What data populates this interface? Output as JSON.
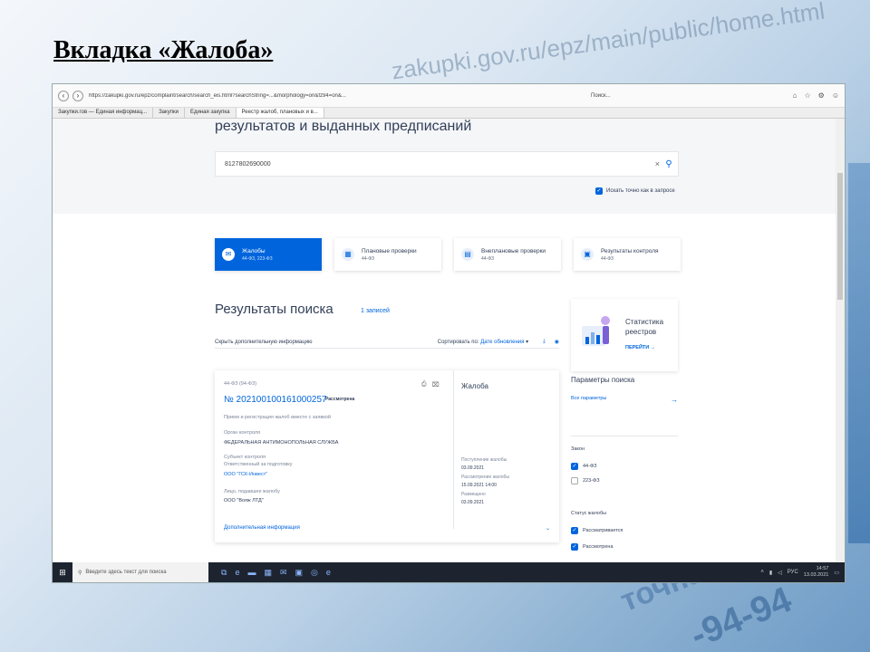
{
  "slide": {
    "title": "Вкладка «Жалоба»"
  },
  "decor": {
    "url_text": "zakupki.gov.ru/epz/main/public/home.html",
    "bottom_text_1": "точная слу",
    "bottom_text_2": "-94-94"
  },
  "browser": {
    "address": "https://zakupki.gov.ru/epz/complaint/search/search_eis.html?searchString=...&morphology=on&fz94=on&...",
    "search_box": "Поиск...",
    "tabs": [
      "Закупки.гов — Единая информац...",
      "Закупки",
      "Единая закупка",
      "Реестр жалоб, плановых и в..."
    ]
  },
  "page": {
    "heading": "результатов и выданных предписаний",
    "search_value": "8127802690000",
    "search_clear": "×",
    "exact_label": "Искать точно как в запросе",
    "cards": [
      {
        "label": "Жалобы",
        "sub": "44-ФЗ, 223-ФЗ",
        "icon": "complaint-icon"
      },
      {
        "label": "Плановые проверки",
        "sub": "44-ФЗ",
        "icon": "calendar-icon"
      },
      {
        "label": "Внеплановые проверки",
        "sub": "44-ФЗ",
        "icon": "document-icon"
      },
      {
        "label": "Результаты контроля",
        "sub": "44-ФЗ",
        "icon": "briefcase-icon"
      }
    ],
    "results_title": "Результаты поиска",
    "results_count": "1 записей",
    "hide_info": "Скрыть дополнительную информацию",
    "sort_label": "Сортировать по:",
    "sort_value": "Дате обновления",
    "result": {
      "law": "44-ФЗ (94-ФЗ)",
      "number": "№ 202100100161000257",
      "status": "Рассмотрена",
      "kind": "Жалоба",
      "description": "Прием и регистрация жалоб вместе с заявкой",
      "organ_label": "Орган контроля",
      "organ_value": "ФЕДЕРАЛЬНАЯ АНТИМОНОПОЛЬНАЯ СЛУЖБА",
      "subject_label": "Субъект контроля",
      "subject_sub_label": "Ответственный за подготовку",
      "subject_value": "ООО \"ГСК-Инвест\"",
      "complainant_label": "Лицо, подавшее жалобу",
      "complainant_value": "ООО \"Вояж ЛТД\"",
      "received_label": "Поступление жалобы",
      "received_value": "03.09.2021",
      "review_label": "Рассмотрение жалобы",
      "review_value": "15.09.2021 14:00",
      "posted_label": "Размещено",
      "posted_value": "03.09.2021",
      "more": "Дополнительная информация"
    },
    "promo": {
      "title_1": "Статистика",
      "title_2": "реестров",
      "link": "ПЕРЕЙТИ"
    },
    "params": {
      "title": "Параметры поиска",
      "link": "Все параметры",
      "law_header": "Закон",
      "law_items": [
        {
          "label": "44-ФЗ",
          "checked": true
        },
        {
          "label": "223-ФЗ",
          "checked": false
        }
      ],
      "status_header": "Статус жалобы",
      "status_items": [
        {
          "label": "Рассматривается",
          "checked": true
        },
        {
          "label": "Рассмотрена",
          "checked": true
        }
      ]
    }
  },
  "taskbar": {
    "search_placeholder": "Введите здесь текст для поиска",
    "lang": "РУС",
    "time": "14:57",
    "date": "13.03.2021"
  }
}
